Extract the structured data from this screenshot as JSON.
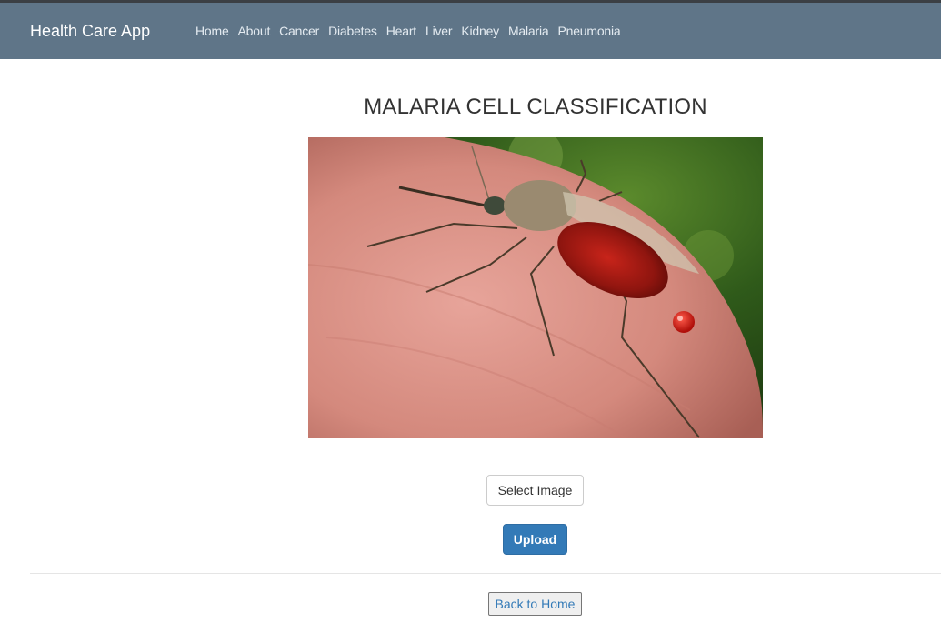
{
  "navbar": {
    "brand": "Health Care App",
    "links": [
      "Home",
      "About",
      "Cancer",
      "Diabetes",
      "Heart",
      "Liver",
      "Kidney",
      "Malaria",
      "Pneumonia"
    ],
    "background_color": "#5f7588"
  },
  "main": {
    "title": "MALARIA CELL CLASSIFICATION",
    "select_button_label": "Select Image",
    "upload_button_label": "Upload",
    "back_button_label": "Back to Home",
    "primary_color": "#337ab7"
  }
}
